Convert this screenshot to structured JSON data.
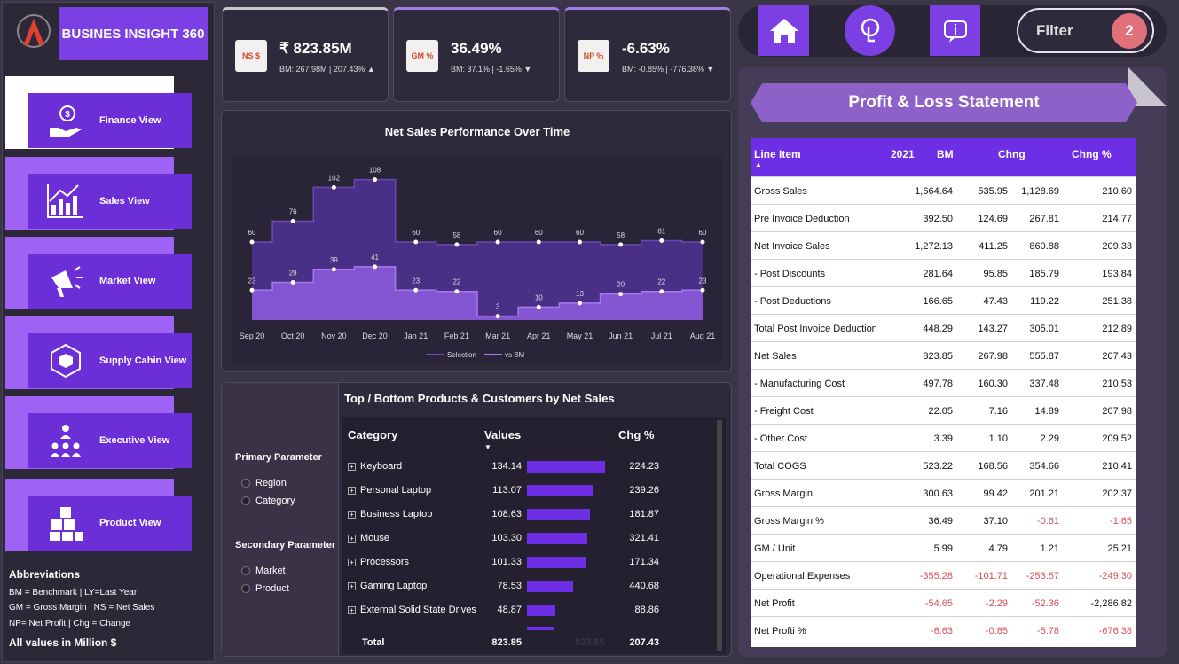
{
  "app": {
    "title": "BUSINES INSIGHT 360"
  },
  "nav": [
    {
      "label": "Finance View",
      "icon": "money-hand-icon",
      "active": true
    },
    {
      "label": "Sales View",
      "icon": "growth-chart-icon"
    },
    {
      "label": "Market View",
      "icon": "megaphone-icon"
    },
    {
      "label": "Supply Cahin View",
      "icon": "supply-network-icon"
    },
    {
      "label": "Executive View",
      "icon": "team-hierarchy-icon"
    },
    {
      "label": "Product View",
      "icon": "boxes-icon"
    }
  ],
  "abbreviations": {
    "title": "Abbreviations",
    "lines": [
      "BM = Benchmark | LY=Last Year",
      "GM = Gross Margin | NS = Net Sales",
      "NP= Net Profit | Chg = Change"
    ],
    "footer": "All values in Million $"
  },
  "kpis": [
    {
      "tag": "NS $",
      "value": "₹ 823.85M",
      "sub": "BM: 267.98M | 207.43% ▲"
    },
    {
      "tag": "GM %",
      "value": "36.49%",
      "sub": "BM: 37.1% | -1.65% ▼"
    },
    {
      "tag": "NP %",
      "value": "-6.63%",
      "sub": "BM: -0.85% | -776.38% ▼"
    }
  ],
  "chart_data": {
    "type": "area",
    "title": "Net Sales Performance Over Time",
    "categories": [
      "Sep 20",
      "Oct 20",
      "Nov 20",
      "Dec 20",
      "Jan 21",
      "Feb 21",
      "Mar 21",
      "Apr 21",
      "May 21",
      "Jun 21",
      "Jul 21",
      "Aug 21"
    ],
    "x_tick_labels": [
      "Sep 20",
      "Oct 20",
      "Nov 20",
      "Dec 20",
      "Jan 21",
      "Feb 21",
      "Mar 21",
      "Apr 21",
      "May 21",
      "Jun 21",
      "Jul 21",
      "Aug 21"
    ],
    "series": [
      {
        "name": "Selection",
        "values": [
          60,
          76,
          102,
          108,
          60,
          58,
          60,
          60,
          60,
          58,
          61,
          60
        ],
        "color": "#4a2f86"
      },
      {
        "name": "vs BM",
        "values": [
          23,
          29,
          39,
          41,
          23,
          22,
          3,
          10,
          13,
          20,
          22,
          23
        ],
        "color": "#8a5ad8"
      }
    ],
    "ylim": [
      0,
      120
    ],
    "legend": "bottom"
  },
  "params": {
    "primary_title": "Primary Parameter",
    "primary": [
      {
        "label": "Region",
        "checked": false
      },
      {
        "label": "Category",
        "checked": true
      }
    ],
    "secondary_title": "Secondary Parameter",
    "secondary": [
      {
        "label": "Market",
        "checked": false
      },
      {
        "label": "Product",
        "checked": true
      }
    ]
  },
  "products": {
    "title": "Top / Bottom Products & Customers by Net Sales",
    "headers": [
      "Category",
      "Values",
      "Chg %"
    ],
    "rows": [
      {
        "name": "Keyboard",
        "value": "134.14",
        "chg": "224.23",
        "v": 134.14
      },
      {
        "name": "Personal Laptop",
        "value": "113.07",
        "chg": "239.26",
        "v": 113.07
      },
      {
        "name": "Business Laptop",
        "value": "108.63",
        "chg": "181.87",
        "v": 108.63
      },
      {
        "name": "Mouse",
        "value": "103.30",
        "chg": "321.41",
        "v": 103.3
      },
      {
        "name": "Processors",
        "value": "101.33",
        "chg": "171.34",
        "v": 101.33
      },
      {
        "name": "Gaming Laptop",
        "value": "78.53",
        "chg": "440.68",
        "v": 78.53
      },
      {
        "name": "External Solid State Drives",
        "value": "48.87",
        "chg": "88.86",
        "v": 48.87
      }
    ],
    "total": {
      "label": "Total",
      "value": "823.85",
      "ghost": "823.85",
      "chg": "207.43"
    }
  },
  "toolbar": {
    "filter_label": "Filter",
    "filter_count": "2"
  },
  "pl": {
    "title": "Profit & Loss Statement",
    "headers": [
      "Line Item",
      "2021",
      "BM",
      "Chng",
      "Chng %"
    ],
    "rows": [
      [
        "Gross Sales",
        "1,664.64",
        "535.95",
        "1,128.69",
        "210.60"
      ],
      [
        "Pre Invoice Deduction",
        "392.50",
        "124.69",
        "267.81",
        "214.77"
      ],
      [
        "Net Invoice Sales",
        "1,272.13",
        "411.25",
        "860.88",
        "209.33"
      ],
      [
        "- Post Discounts",
        "281.64",
        "95.85",
        "185.79",
        "193.84"
      ],
      [
        "- Post Deductions",
        "166.65",
        "47.43",
        "119.22",
        "251.38"
      ],
      [
        "Total Post Invoice Deduction",
        "448.29",
        "143.27",
        "305.01",
        "212.89"
      ],
      [
        "Net Sales",
        "823.85",
        "267.98",
        "555.87",
        "207.43"
      ],
      [
        "- Manufacturing Cost",
        "497.78",
        "160.30",
        "337.48",
        "210.53"
      ],
      [
        "- Freight Cost",
        "22.05",
        "7.16",
        "14.89",
        "207.98"
      ],
      [
        "- Other Cost",
        "3.39",
        "1.10",
        "2.29",
        "209.52"
      ],
      [
        "Total COGS",
        "523.22",
        "168.56",
        "354.66",
        "210.41"
      ],
      [
        "Gross Margin",
        "300.63",
        "99.42",
        "201.21",
        "202.37"
      ],
      [
        "Gross Margin %",
        "36.49",
        "37.10",
        "-0.61",
        "-1.65"
      ],
      [
        "GM / Unit",
        "5.99",
        "4.79",
        "1.21",
        "25.21"
      ],
      [
        "Operational Expenses",
        "-355.28",
        "-101.71",
        "-253.57",
        "-249.30"
      ],
      [
        "Net Profit",
        "-54.65",
        "-2.29",
        "-52.36",
        "-2,286.82"
      ],
      [
        "Net Profti %",
        "-6.63",
        "-0.85",
        "-5.78",
        "-676.38"
      ]
    ],
    "negative_color": "#d9505a"
  }
}
